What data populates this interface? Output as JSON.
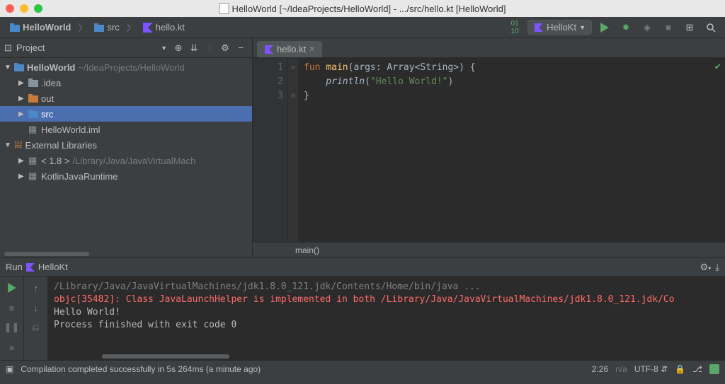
{
  "window": {
    "title": "HelloWorld [~/IdeaProjects/HelloWorld] - .../src/hello.kt [HelloWorld]"
  },
  "breadcrumb": {
    "root": "HelloWorld",
    "items": [
      "src",
      "hello.kt"
    ]
  },
  "toolbar": {
    "build_icon": "↕",
    "run_config_label": "HelloKt"
  },
  "project_tool": {
    "title": "Project"
  },
  "tree": {
    "root_name": "HelloWorld",
    "root_path": "~/IdeaProjects/HelloWorld",
    "idea": ".idea",
    "out": "out",
    "src": "src",
    "iml": "HelloWorld.iml",
    "ext_lib": "External Libraries",
    "jdk": "< 1.8 >",
    "jdk_path": "/Library/Java/JavaVirtualMach",
    "kotlin_rt": "KotlinJavaRuntime"
  },
  "editor": {
    "tab_name": "hello.kt",
    "lines": {
      "l1_kw": "fun ",
      "l1_fn": "main",
      "l1_rest1": "(args: Array<String>) {",
      "l2_call": "    println",
      "l2_p1": "(",
      "l2_str": "\"Hello World!\"",
      "l2_p2": ")",
      "l3": "}"
    },
    "gutter": [
      "1",
      "2",
      "3"
    ],
    "breadcrumb_bottom": "main()"
  },
  "run": {
    "header": "Run",
    "config": "HelloKt",
    "lines": {
      "l1": "/Library/Java/JavaVirtualMachines/jdk1.8.0_121.jdk/Contents/Home/bin/java ...",
      "l2": "objc[35482]: Class JavaLaunchHelper is implemented in both /Library/Java/JavaVirtualMachines/jdk1.8.0_121.jdk/Co",
      "l3": "Hello World!",
      "l4": "",
      "l5": "Process finished with exit code 0"
    }
  },
  "status": {
    "msg": "Compilation completed successfully in 5s 264ms (a minute ago)",
    "cursor": "2:26",
    "na": "n/a",
    "encoding": "UTF-8",
    "lock": "🔒"
  }
}
